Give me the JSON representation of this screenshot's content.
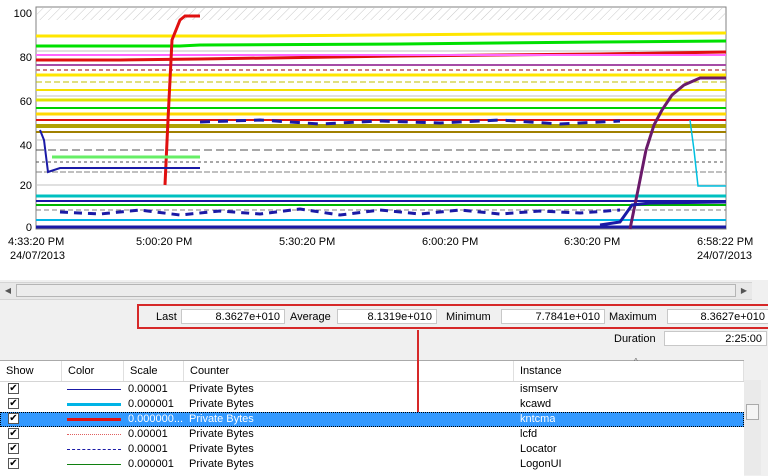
{
  "graph": {
    "y_ticks": [
      "100",
      "80",
      "60",
      "40",
      "20",
      "0"
    ],
    "x_ticks": [
      "4:33:20 PM",
      "5:00:20 PM",
      "5:30:20 PM",
      "6:00:20 PM",
      "6:30:20 PM",
      "6:58:22 PM"
    ],
    "start_date": "24/07/2013",
    "end_date": "24/07/2013"
  },
  "stats": {
    "last_label": "Last",
    "last_value": "8.3627e+010",
    "average_label": "Average",
    "average_value": "8.1319e+010",
    "minimum_label": "Minimum",
    "minimum_value": "7.7841e+010",
    "maximum_label": "Maximum",
    "maximum_value": "8.3627e+010",
    "duration_label": "Duration",
    "duration_value": "2:25:00"
  },
  "table": {
    "headers": {
      "show": "Show",
      "color": "Color",
      "scale": "Scale",
      "counter": "Counter",
      "instance": "Instance"
    },
    "rows": [
      {
        "checked": "✔",
        "color": "#1a1aa6",
        "style": "solid",
        "width": 1,
        "scale": "0.00001",
        "counter": "Private Bytes",
        "instance": "ismserv"
      },
      {
        "checked": "✔",
        "color": "#00b4e6",
        "style": "solid",
        "width": 3,
        "scale": "0.000001",
        "counter": "Private Bytes",
        "instance": "kcawd"
      },
      {
        "checked": "✔",
        "color": "#e01010",
        "style": "solid",
        "width": 3,
        "scale": "0.000000...",
        "counter": "Private Bytes",
        "instance": "kntcma"
      },
      {
        "checked": "✔",
        "color": "#e06060",
        "style": "dotted",
        "width": 1,
        "scale": "0.00001",
        "counter": "Private Bytes",
        "instance": "lcfd"
      },
      {
        "checked": "✔",
        "color": "#1a1aa6",
        "style": "dashed",
        "width": 1,
        "scale": "0.00001",
        "counter": "Private Bytes",
        "instance": "Locator"
      },
      {
        "checked": "✔",
        "color": "#108010",
        "style": "solid",
        "width": 1,
        "scale": "0.000001",
        "counter": "Private Bytes",
        "instance": "LogonUI"
      }
    ]
  }
}
